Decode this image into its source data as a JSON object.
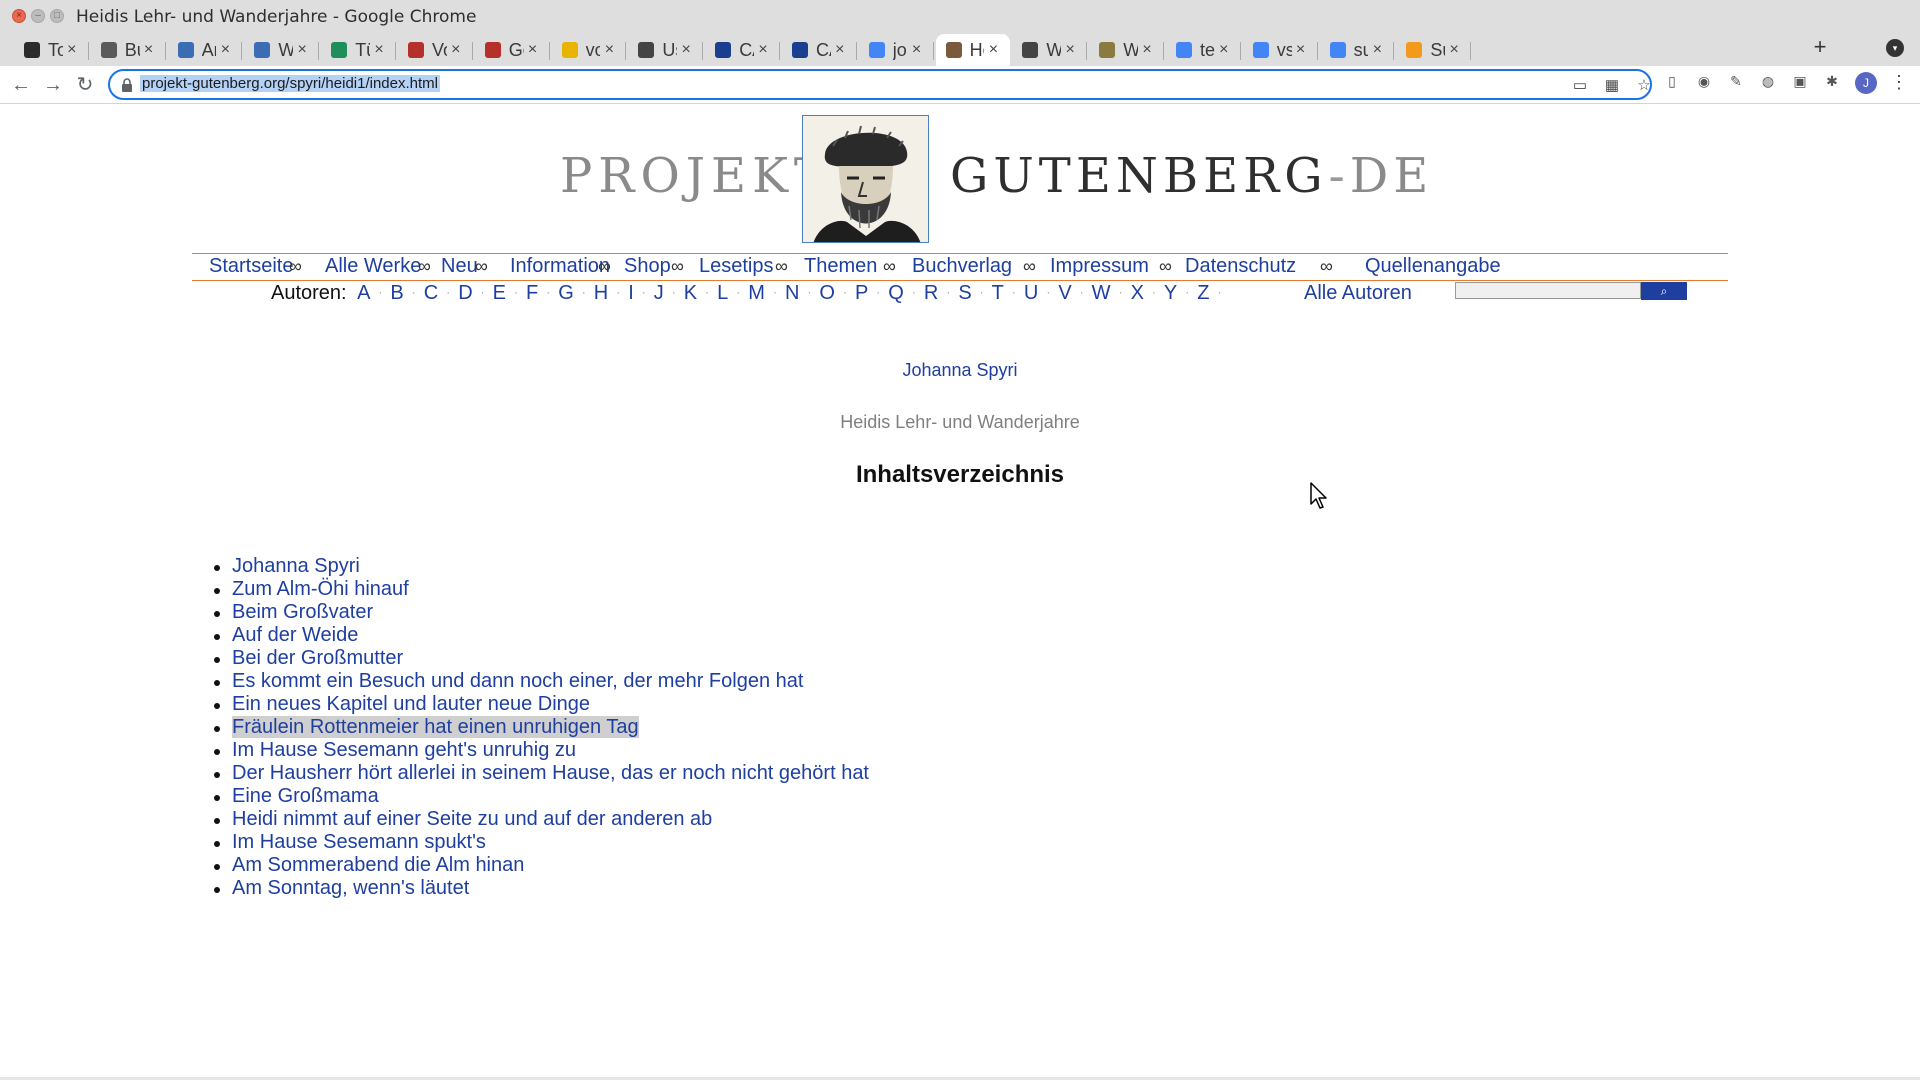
{
  "window": {
    "title": "Heidis Lehr- und Wanderjahre - Google Chrome",
    "controls": [
      "×",
      "–",
      "□"
    ]
  },
  "tabs": [
    {
      "label": "Tod",
      "icon": "checkbox-icon"
    },
    {
      "label": "Buc",
      "icon": "book-icon"
    },
    {
      "label": "Ann",
      "icon": "clip-icon"
    },
    {
      "label": "Wel",
      "icon": "clip-icon"
    },
    {
      "label": "TüN",
      "icon": "tree-icon"
    },
    {
      "label": "Voy",
      "icon": "crest-icon"
    },
    {
      "label": "Get",
      "icon": "crest-icon"
    },
    {
      "label": "voy",
      "icon": "chrome-icon"
    },
    {
      "label": "Usir",
      "icon": "globe-icon"
    },
    {
      "label": "CAT",
      "icon": "shield-icon"
    },
    {
      "label": "CAT",
      "icon": "shield-icon"
    },
    {
      "label": "joha",
      "icon": "google-icon"
    },
    {
      "label": "Hei",
      "icon": "gutenberg-icon",
      "active": true
    },
    {
      "label": "Wel",
      "icon": "globe-icon"
    },
    {
      "label": "Wel",
      "icon": "doc-icon"
    },
    {
      "label": "text",
      "icon": "google-icon"
    },
    {
      "label": "vsc",
      "icon": "google-icon"
    },
    {
      "label": "sub",
      "icon": "google-icon"
    },
    {
      "label": "Sub",
      "icon": "sublime-icon"
    }
  ],
  "tab_close": "×",
  "new_tab": "+",
  "toolbar": {
    "back": "←",
    "forward": "→",
    "reload": "↻",
    "url": "projekt-gutenberg.org/spyri/heidi1/index.html",
    "avatar_letter": "J"
  },
  "logo": {
    "left": "PROJEKT",
    "right_main": "GUTENBERG",
    "right_dash": "-",
    "right_de": "DE"
  },
  "nav": {
    "items": [
      "Startseite",
      "Alle Werke",
      "Neu",
      "Information",
      "Shop",
      "Lesetips",
      "Themen",
      "Buchverlag",
      "Impressum",
      "Datenschutz",
      "Quellenangabe"
    ],
    "separator": "∞"
  },
  "authors": {
    "label": "Autoren:",
    "letters": [
      "A",
      "B",
      "C",
      "D",
      "E",
      "F",
      "G",
      "H",
      "I",
      "J",
      "K",
      "L",
      "M",
      "N",
      "O",
      "P",
      "Q",
      "R",
      "S",
      "T",
      "U",
      "V",
      "W",
      "X",
      "Y",
      "Z"
    ],
    "separator": "·",
    "all_link": "Alle Autoren",
    "search_button": "⌕"
  },
  "content": {
    "author": "Johanna Spyri",
    "book_title": "Heidis Lehr- und Wanderjahre",
    "heading": "Inhaltsverzeichnis",
    "toc": [
      "Johanna Spyri",
      "Zum Alm-Öhi hinauf",
      "Beim Großvater",
      "Auf der Weide",
      "Bei der Großmutter",
      "Es kommt ein Besuch und dann noch einer, der mehr Folgen hat",
      "Ein neues Kapitel und lauter neue Dinge",
      "Fräulein Rottenmeier hat einen unruhigen Tag",
      "Im Hause Sesemann geht's unruhig zu",
      "Der Hausherr hört allerlei in seinem Hause, das er noch nicht gehört hat",
      "Eine Großmama",
      "Heidi nimmt auf einer Seite zu und auf der anderen ab",
      "Im Hause Sesemann spukt's",
      "Am Sommerabend die Alm hinan",
      "Am Sonntag, wenn's läutet"
    ],
    "highlighted_index": 7
  },
  "colors": {
    "link": "#1f3fa0",
    "nav_rule": "#e87a30",
    "omnibox_focus": "#1a73e8"
  }
}
